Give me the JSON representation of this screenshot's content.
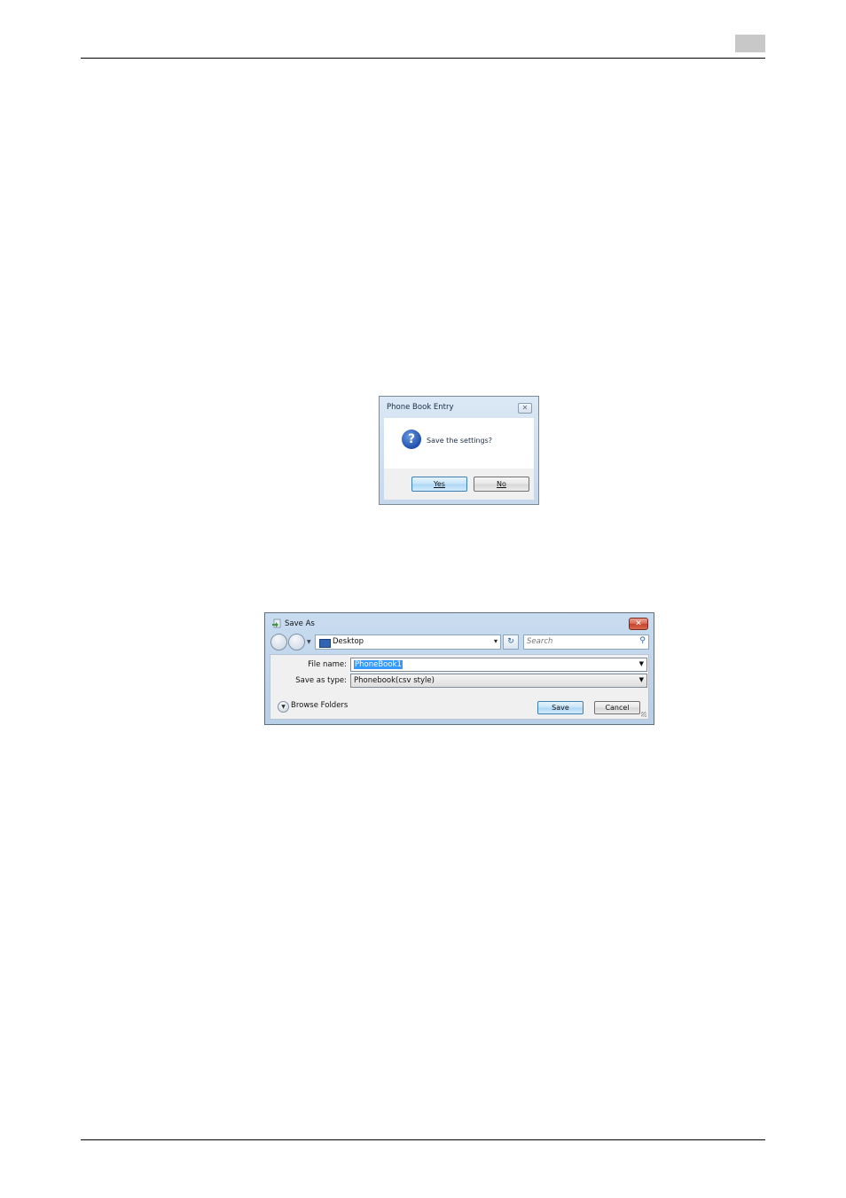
{
  "dialog_confirm": {
    "title": "Phone Book Entry",
    "close_glyph": "✕",
    "icon": "question-icon",
    "question_glyph": "?",
    "message": "Save the settings?",
    "yes_label": "Yes",
    "no_label": "No"
  },
  "dialog_save": {
    "title": "Save As",
    "close_glyph": "✕",
    "location": "Desktop",
    "search_placeholder": "Search",
    "file_name_label": "File name:",
    "file_name_value": "PhoneBook1",
    "save_type_label": "Save as type:",
    "save_type_value": "Phonebook(csv style)",
    "browse_folders_label": "Browse Folders",
    "save_label": "Save",
    "cancel_label": "Cancel"
  },
  "colors": {
    "selection": "#3399ff",
    "close_red": "#c7402b",
    "question_blue": "#1f4fae"
  }
}
